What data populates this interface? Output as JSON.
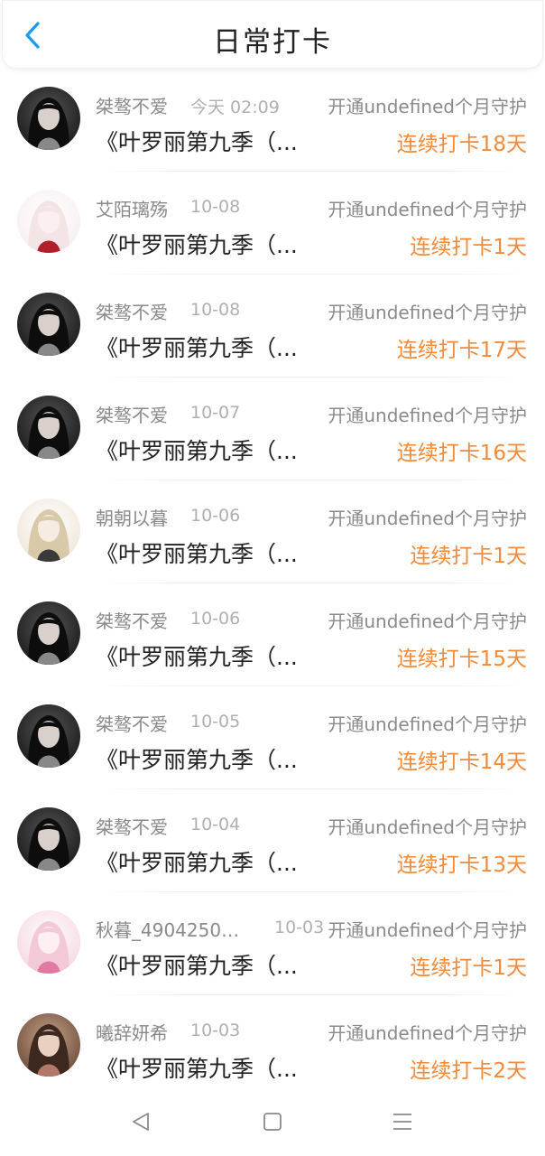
{
  "header": {
    "title": "日常打卡",
    "back_icon": "chevron-left-icon"
  },
  "colors": {
    "accent": "#1a9af0",
    "streak": "#f28a3c",
    "muted": "#8a8a8a",
    "date": "#b0b0b0"
  },
  "items": [
    {
      "name": "桀骜不爱",
      "date": "今天 02:09",
      "guard": "开通undefined个月守护",
      "content": "《叶罗丽第九季（...",
      "streak": "连续打卡18天",
      "avatar": "dark"
    },
    {
      "name": "艾陌璃殇",
      "date": "10-08",
      "guard": "开通undefined个月守护",
      "content": "《叶罗丽第九季（...",
      "streak": "连续打卡1天",
      "avatar": "pink-white"
    },
    {
      "name": "桀骜不爱",
      "date": "10-08",
      "guard": "开通undefined个月守护",
      "content": "《叶罗丽第九季（...",
      "streak": "连续打卡17天",
      "avatar": "dark"
    },
    {
      "name": "桀骜不爱",
      "date": "10-07",
      "guard": "开通undefined个月守护",
      "content": "《叶罗丽第九季（...",
      "streak": "连续打卡16天",
      "avatar": "dark"
    },
    {
      "name": "朝朝以暮",
      "date": "10-06",
      "guard": "开通undefined个月守护",
      "content": "《叶罗丽第九季（...",
      "streak": "连续打卡1天",
      "avatar": "beige"
    },
    {
      "name": "桀骜不爱",
      "date": "10-06",
      "guard": "开通undefined个月守护",
      "content": "《叶罗丽第九季（...",
      "streak": "连续打卡15天",
      "avatar": "dark"
    },
    {
      "name": "桀骜不爱",
      "date": "10-05",
      "guard": "开通undefined个月守护",
      "content": "《叶罗丽第九季（...",
      "streak": "连续打卡14天",
      "avatar": "dark"
    },
    {
      "name": "桀骜不爱",
      "date": "10-04",
      "guard": "开通undefined个月守护",
      "content": "《叶罗丽第九季（...",
      "streak": "连续打卡13天",
      "avatar": "dark"
    },
    {
      "name": "秋暮_49042500...",
      "date": "10-03",
      "guard": "开通undefined个月守护",
      "content": "《叶罗丽第九季（...",
      "streak": "连续打卡1天",
      "avatar": "pink"
    },
    {
      "name": "曦辞妍希",
      "date": "10-03",
      "guard": "开通undefined个月守护",
      "content": "《叶罗丽第九季（...",
      "streak": "连续打卡2天",
      "avatar": "brown"
    }
  ],
  "navbar": {
    "back": "triangle-back-icon",
    "home": "square-home-icon",
    "menu": "menu-lines-icon"
  }
}
